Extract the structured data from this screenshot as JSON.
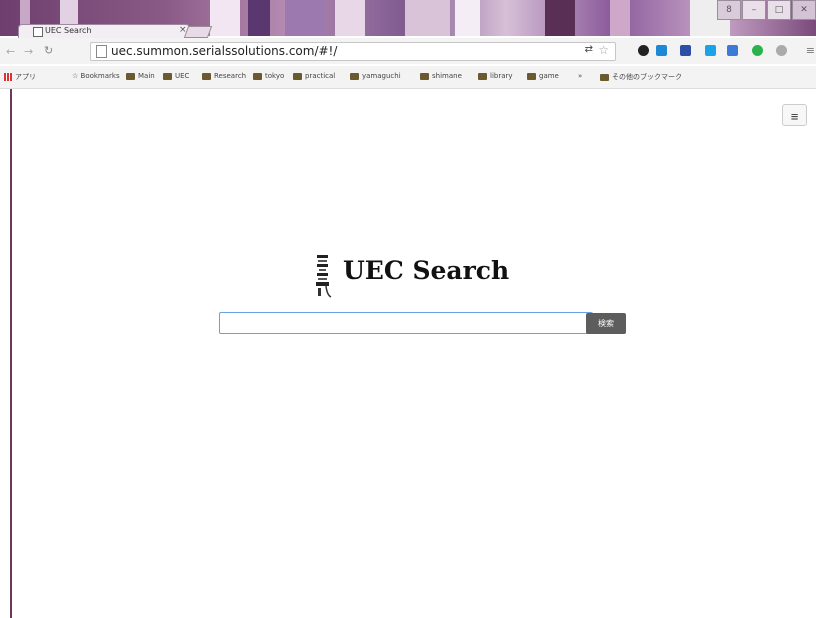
{
  "browser": {
    "tab_title": "UEC Search",
    "tab_close": "×",
    "url": "uec.summon.serialssolutions.com/#!/",
    "window_buttons": {
      "user": "8",
      "minimize": "–",
      "maximize": "□",
      "close": "✕"
    },
    "translate_icon": "translate-icon",
    "bookmark_star_icon": "star-icon"
  },
  "bookmarks": {
    "apps_label": "アプリ",
    "items": [
      "Bookmarks",
      "Main",
      "UEC",
      "Research",
      "tokyo",
      "practical",
      "yamaguchi",
      "shimane",
      "library",
      "game"
    ],
    "more": "»",
    "other_bookmarks": "その他のブックマーク"
  },
  "header": {
    "menu_icon": "hamburger-icon",
    "menu_glyph": "≡"
  },
  "main": {
    "logo_text": "UEC Search",
    "search_placeholder": "",
    "search_value": "",
    "search_button": "検索"
  },
  "colors": {
    "theme_purple": "#6e3f6e",
    "input_border": "#66a3e0",
    "button_bg": "#5d5d5d"
  }
}
